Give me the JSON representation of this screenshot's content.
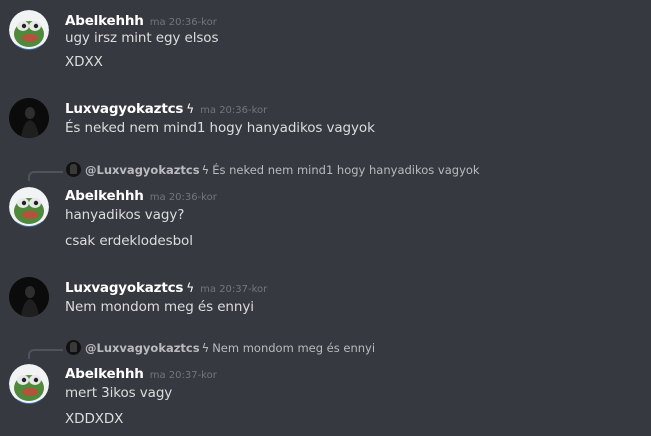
{
  "messages": [
    {
      "author": "Abelkehhh",
      "bolt": "",
      "time": "ma 20:36-kor",
      "lines": [
        "ugy irsz mint egy elsos",
        "XDXX"
      ]
    },
    {
      "author": "Luxvagyokaztcs",
      "bolt": "ϟ",
      "time": "ma 20:36-kor",
      "lines": [
        "És neked nem mind1 hogy hanyadikos vagyok"
      ]
    },
    {
      "reply": {
        "author": "@Luxvagyokaztcs",
        "bolt": "ϟ",
        "text": "És neked nem mind1 hogy hanyadikos vagyok"
      },
      "author": "Abelkehhh",
      "bolt": "",
      "time": "ma 20:36-kor",
      "lines": [
        "hanyadikos vagy?",
        "csak erdeklodesbol"
      ]
    },
    {
      "author": "Luxvagyokaztcs",
      "bolt": "ϟ",
      "time": "ma 20:37-kor",
      "lines": [
        "Nem mondom meg és ennyi"
      ]
    },
    {
      "reply": {
        "author": "@Luxvagyokaztcs",
        "bolt": "ϟ",
        "text": "Nem mondom meg és ennyi"
      },
      "author": "Abelkehhh",
      "bolt": "",
      "time": "ma 20:37-kor",
      "lines": [
        "mert 3ikos vagy",
        "XDDXDX"
      ]
    }
  ]
}
